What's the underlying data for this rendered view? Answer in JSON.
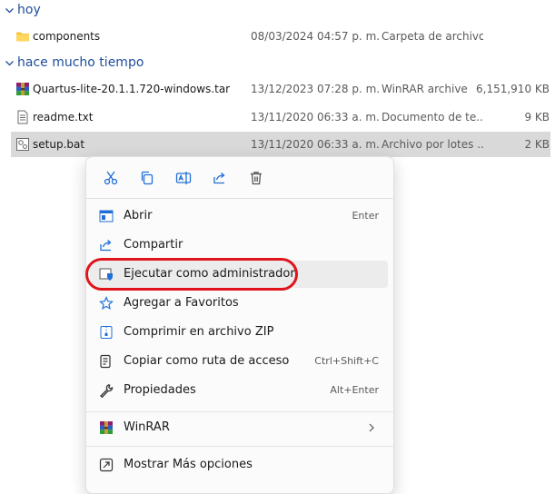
{
  "groups": [
    {
      "label": "hoy"
    },
    {
      "label": "hace mucho tiempo"
    }
  ],
  "files": [
    {
      "name": "components",
      "date": "08/03/2024 04:57 p. m.",
      "type": "Carpeta de archivos",
      "size": "",
      "icon": "folder-icon",
      "selected": false
    },
    {
      "name": "Quartus-lite-20.1.1.720-windows.tar",
      "date": "13/12/2023 07:28 p. m.",
      "type": "WinRAR archive",
      "size": "6,151,910 KB",
      "icon": "winrar-archive-icon",
      "selected": false
    },
    {
      "name": "readme.txt",
      "date": "13/11/2020 06:33 a. m.",
      "type": "Documento de te...",
      "size": "9 KB",
      "icon": "text-document-icon",
      "selected": false
    },
    {
      "name": "setup.bat",
      "date": "13/11/2020 06:33 a. m.",
      "type": "Archivo por lotes ...",
      "size": "2 KB",
      "icon": "batch-file-icon",
      "selected": true
    }
  ],
  "context_menu": {
    "quick_actions": [
      {
        "name": "cut-icon",
        "title": "Cortar"
      },
      {
        "name": "copy-icon",
        "title": "Copiar"
      },
      {
        "name": "rename-icon",
        "title": "Cambiar nombre"
      },
      {
        "name": "share-icon",
        "title": "Compartir"
      },
      {
        "name": "delete-icon",
        "title": "Eliminar"
      }
    ],
    "items": [
      {
        "label": "Abrir",
        "shortcut": "Enter",
        "icon": "open-icon"
      },
      {
        "label": "Compartir",
        "shortcut": "",
        "icon": "share-icon"
      },
      {
        "label": "Ejecutar como administrador",
        "shortcut": "",
        "icon": "run-as-admin-icon",
        "hovered": true
      },
      {
        "label": "Agregar a Favoritos",
        "shortcut": "",
        "icon": "star-icon"
      },
      {
        "label": "Comprimir en archivo ZIP",
        "shortcut": "",
        "icon": "zip-icon"
      },
      {
        "label": "Copiar como ruta de acceso",
        "shortcut": "Ctrl+Shift+C",
        "icon": "copy-path-icon"
      },
      {
        "label": "Propiedades",
        "shortcut": "Alt+Enter",
        "icon": "wrench-icon"
      },
      {
        "label": "WinRAR",
        "shortcut": "",
        "icon": "winrar-icon",
        "submenu": true
      },
      {
        "label": "Mostrar Más opciones",
        "shortcut": "",
        "icon": "more-options-icon"
      }
    ]
  },
  "colors": {
    "group_header": "#1f4e9c",
    "selected_row": "#d9d9d9",
    "annotation": "#e0141b",
    "accent_icon": "#1f6fd6"
  }
}
